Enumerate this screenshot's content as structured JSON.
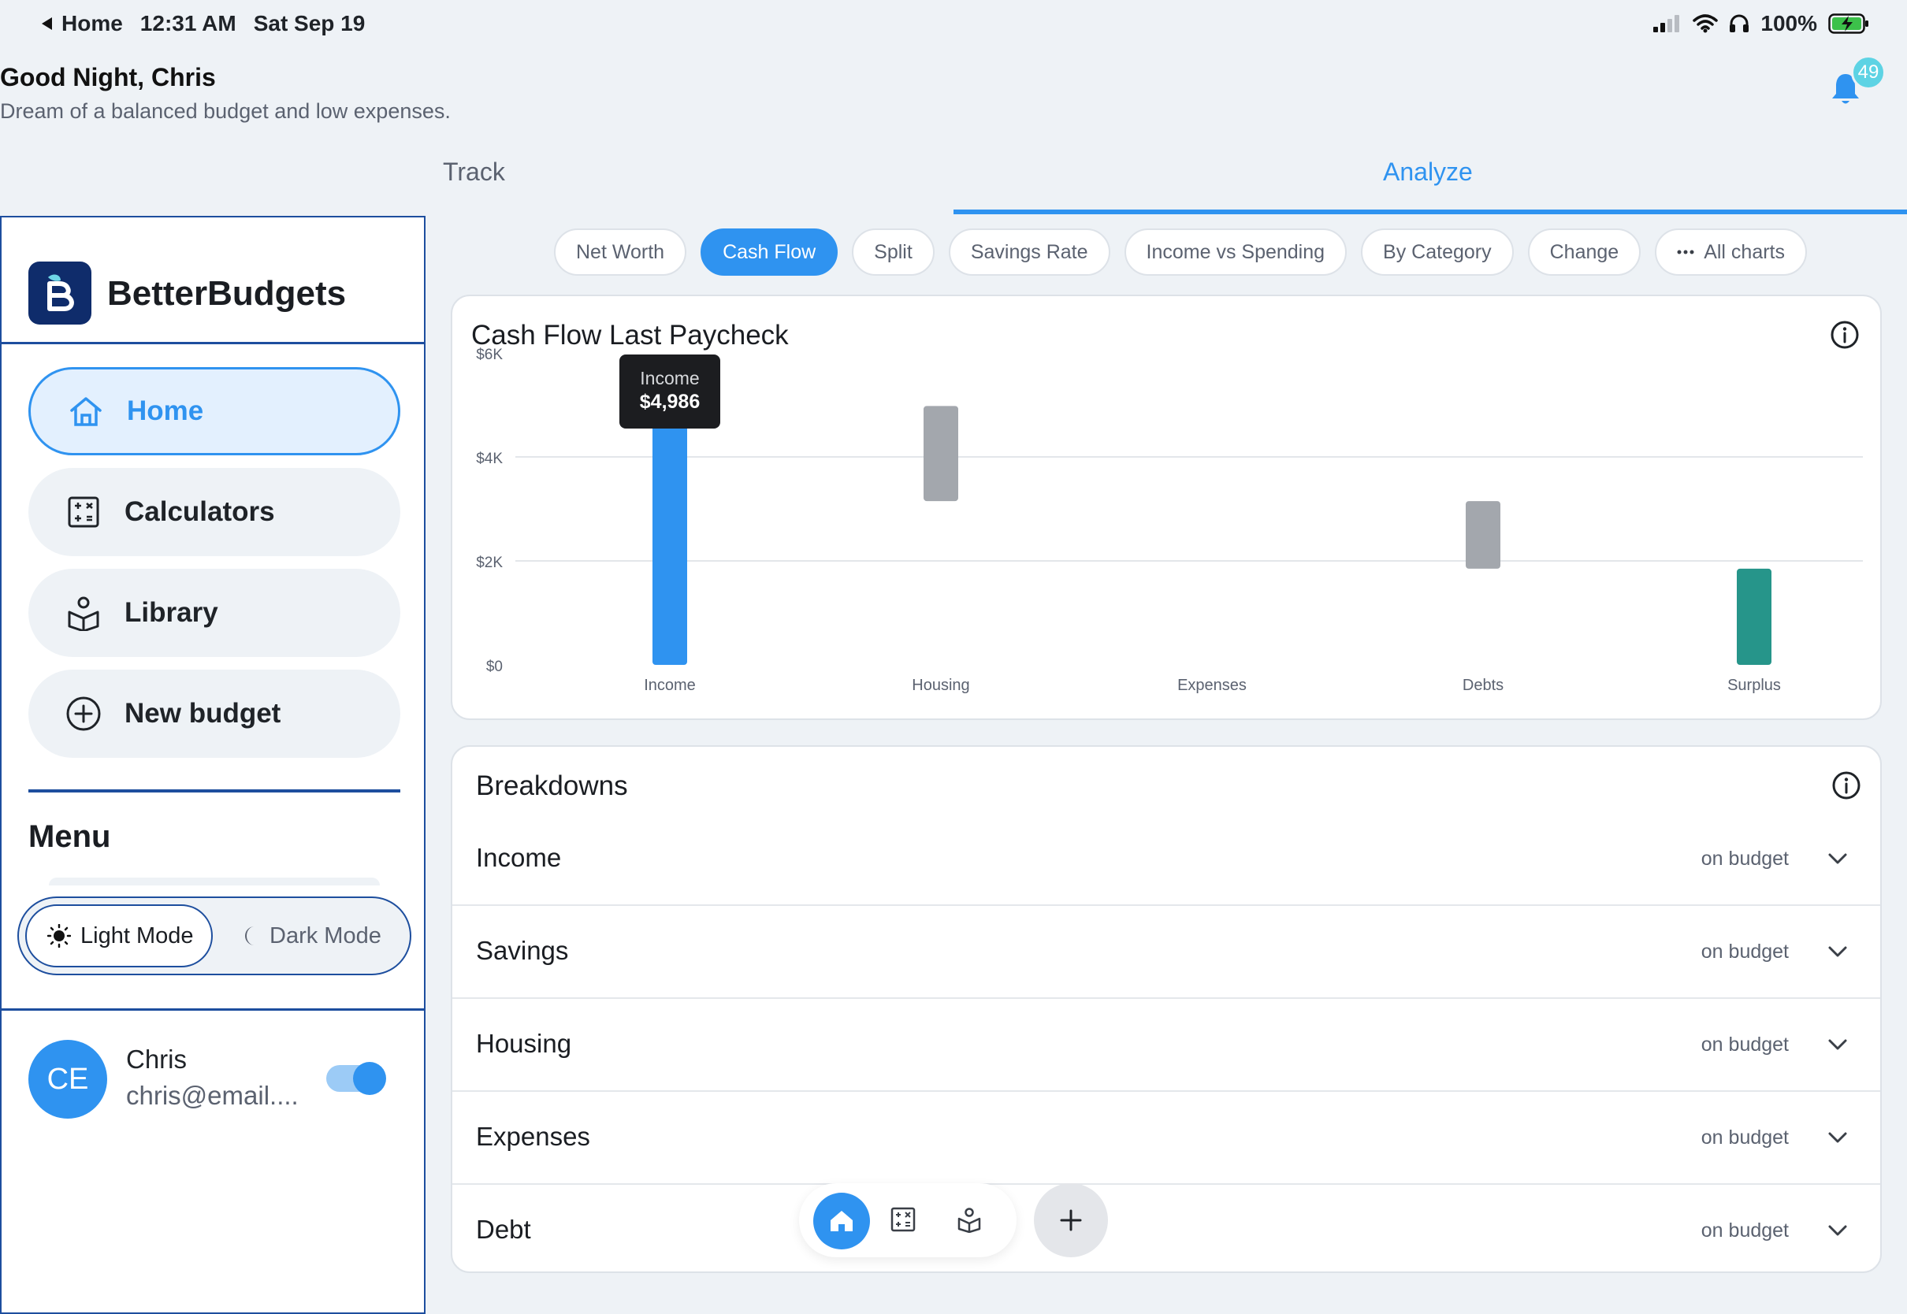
{
  "status_bar": {
    "back_label": "Home",
    "time": "12:31 AM",
    "date": "Sat Sep 19",
    "battery": "100%"
  },
  "header": {
    "greeting": "Good Night, Chris",
    "subtitle": "Dream of a balanced budget and low expenses.",
    "notification_count": "49"
  },
  "top_tabs": {
    "track": "Track",
    "analyze": "Analyze",
    "active": "Analyze"
  },
  "sidebar": {
    "brand": "BetterBudgets",
    "logo_letter": "B",
    "items": [
      {
        "label": "Home",
        "icon": "home-icon",
        "active": true
      },
      {
        "label": "Calculators",
        "icon": "calculator-icon",
        "active": false
      },
      {
        "label": "Library",
        "icon": "library-icon",
        "active": false
      },
      {
        "label": "New budget",
        "icon": "plus-circle-icon",
        "active": false
      }
    ],
    "menu_title": "Menu",
    "modes": {
      "light": "Light Mode",
      "dark": "Dark Mode",
      "selected": "Light Mode"
    },
    "user": {
      "initials": "CE",
      "name": "Chris",
      "email": "chris@email...."
    }
  },
  "chart_pills": [
    "Net Worth",
    "Cash Flow",
    "Split",
    "Savings Rate",
    "Income vs Spending",
    "By Category",
    "Change",
    "All charts"
  ],
  "active_pill": "Cash Flow",
  "chart_card": {
    "title": "Cash Flow Last Paycheck",
    "tooltip": {
      "label": "Income",
      "value": "$4,986"
    }
  },
  "chart_data": {
    "type": "bar",
    "subtype": "waterfall",
    "title": "Cash Flow Last Paycheck",
    "categories": [
      "Income",
      "Housing",
      "Expenses",
      "Debts",
      "Surplus"
    ],
    "bars": [
      {
        "category": "Income",
        "start": 0,
        "end": 4986,
        "color": "#2f93f0"
      },
      {
        "category": "Housing",
        "start": 3150,
        "end": 4980,
        "color": "#a3a7ad"
      },
      {
        "category": "Expenses",
        "start": 3150,
        "end": 3150,
        "color": "#a3a7ad"
      },
      {
        "category": "Debts",
        "start": 1850,
        "end": 3150,
        "color": "#a3a7ad"
      },
      {
        "category": "Surplus",
        "start": 0,
        "end": 1850,
        "color": "#26958a"
      }
    ],
    "y_ticks": [
      "$0",
      "$2K",
      "$4K",
      "$6K"
    ],
    "ylim": [
      0,
      6000
    ],
    "grid": true
  },
  "breakdowns": {
    "title": "Breakdowns",
    "rows": [
      {
        "name": "Income",
        "status": "on budget"
      },
      {
        "name": "Savings",
        "status": "on budget"
      },
      {
        "name": "Housing",
        "status": "on budget"
      },
      {
        "name": "Expenses",
        "status": "on budget"
      },
      {
        "name": "Debt",
        "status": "on budget"
      }
    ]
  },
  "colors": {
    "accent": "#2f93f0",
    "navy": "#1d4e9e",
    "surplus": "#26958a",
    "neutral_bar": "#a3a7ad"
  }
}
